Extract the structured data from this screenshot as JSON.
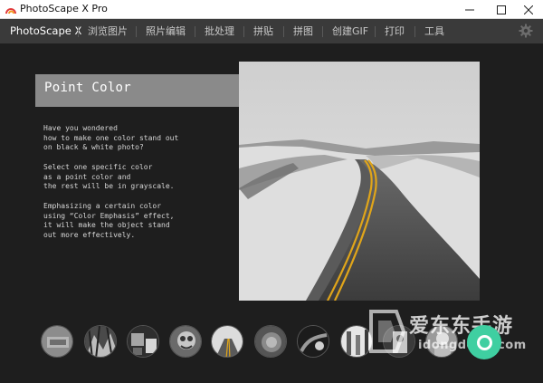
{
  "window": {
    "title": "PhotoScape X Pro",
    "buttons": [
      "minimize-icon",
      "maximize-icon",
      "close-icon"
    ]
  },
  "menu": {
    "brand": "PhotoScape X",
    "items": [
      "浏览图片",
      "照片编辑",
      "批处理",
      "拼贴",
      "拼图",
      "创建GIF",
      "打印",
      "工具"
    ],
    "settings_icon": "gear-icon"
  },
  "feature": {
    "title": "Point Color",
    "paragraphs": [
      "Have you wondered\nhow to make one color stand out\non black & white photo?",
      "Select one specific color\nas a point color and\nthe rest will be in grayscale.",
      "Emphasizing a certain color\nusing “Color Emphasis” effect,\nit will make the object stand\nout more effectively."
    ]
  },
  "filmstrip": {
    "thumbnails": [
      "thumbnail-1",
      "thumbnail-2",
      "thumbnail-3",
      "thumbnail-4",
      "thumbnail-5",
      "thumbnail-6",
      "thumbnail-7",
      "thumbnail-8",
      "thumbnail-9",
      "thumbnail-10"
    ],
    "action_icon": "circle-icon"
  },
  "watermark": {
    "text": "爱东东手游",
    "subtext": "idongdong.com"
  },
  "colors": {
    "background": "#1e1e1e",
    "menu_bar": "#3a3a3a",
    "banner": "#8a8a8a",
    "accent": "#3fcfa1"
  }
}
